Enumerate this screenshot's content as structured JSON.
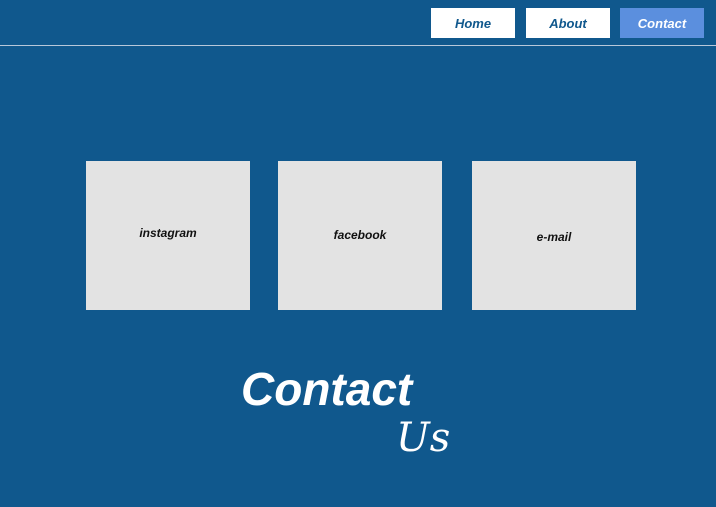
{
  "nav": {
    "home_label": "Home",
    "about_label": "About",
    "contact_label": "Contact"
  },
  "cards": [
    {
      "label": "instagram"
    },
    {
      "label": "facebook"
    },
    {
      "label": "e-mail"
    }
  ],
  "heading": {
    "line1": "Contact",
    "line2": "Us"
  },
  "colors": {
    "background": "#10588d",
    "nav_button": "#ffffff",
    "nav_button_active": "#5b8fde",
    "card": "#e3e3e3"
  }
}
